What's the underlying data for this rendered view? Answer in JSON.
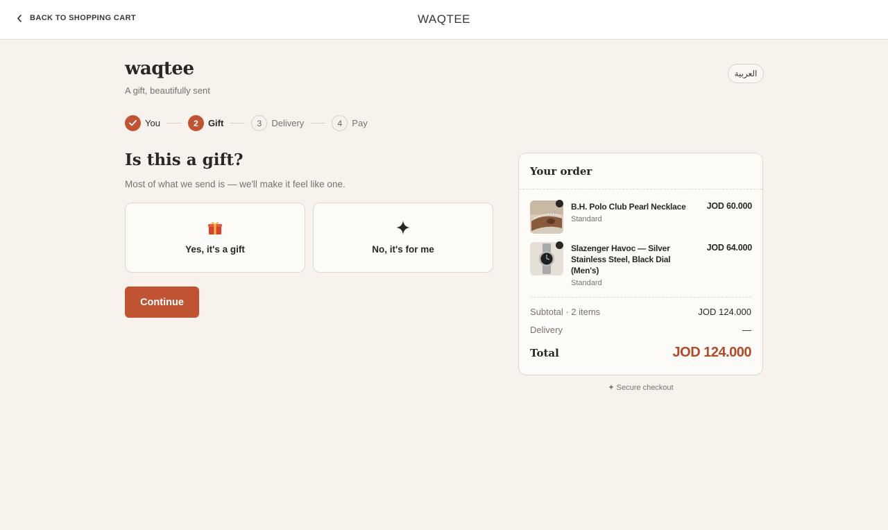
{
  "topbar": {
    "back_label": "BACK TO SHOPPING CART",
    "store_name": "WAQTEE"
  },
  "brand": {
    "name": "waqtee",
    "tagline": "A gift, beautifully sent",
    "language_button": "العربية"
  },
  "stepper": {
    "steps": [
      {
        "number": "1",
        "label": "You",
        "state": "done"
      },
      {
        "number": "2",
        "label": "Gift",
        "state": "active"
      },
      {
        "number": "3",
        "label": "Delivery",
        "state": "pending"
      },
      {
        "number": "4",
        "label": "Pay",
        "state": "pending"
      }
    ]
  },
  "main": {
    "question": "Is this a gift?",
    "subtext": "Most of what we send is — we'll make it feel like one.",
    "options": [
      {
        "label": "Yes, it's a gift",
        "icon": "gift-icon"
      },
      {
        "label": "No, it's for me",
        "icon": "sparkle-icon"
      }
    ],
    "continue_label": "Continue"
  },
  "order": {
    "title": "Your order",
    "items": [
      {
        "name": "B.H. Polo Club Pearl Necklace",
        "variant": "Standard",
        "price": "JOD 60.000",
        "image": "necklace-thumbnail"
      },
      {
        "name": "Slazenger Havoc — Silver Stainless Steel, Black Dial (Men's)",
        "variant": "Standard",
        "price": "JOD 64.000",
        "image": "watch-thumbnail"
      }
    ],
    "subtotal_label": "Subtotal · 2 items",
    "subtotal_value": "JOD 124.000",
    "delivery_label": "Delivery",
    "delivery_value": "—",
    "total_label": "Total",
    "total_value": "JOD 124.000"
  },
  "secure_label": "✦ Secure checkout",
  "colors": {
    "accent": "#bf5332",
    "total": "#b04a2a",
    "background": "#f7f3ec",
    "card": "#fdfbf7"
  }
}
